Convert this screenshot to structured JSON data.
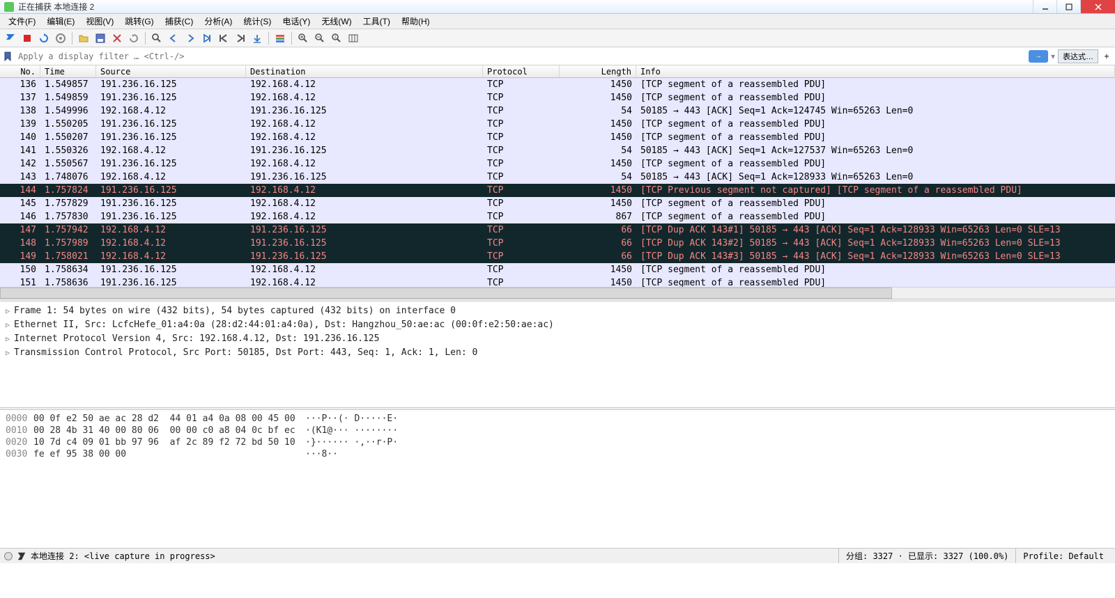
{
  "window": {
    "title": "正在捕获 本地连接 2"
  },
  "menu": {
    "file": "文件(F)",
    "edit": "编辑(E)",
    "view": "视图(V)",
    "goto": "跳转(G)",
    "capture": "捕获(C)",
    "analyze": "分析(A)",
    "stats": "统计(S)",
    "telephony": "电话(Y)",
    "wireless": "无线(W)",
    "tools": "工具(T)",
    "help": "帮助(H)"
  },
  "filter": {
    "placeholder": "Apply a display filter … <Ctrl-/>",
    "expression": "表达式…"
  },
  "columns": {
    "no": "No.",
    "time": "Time",
    "source": "Source",
    "destination": "Destination",
    "protocol": "Protocol",
    "length": "Length",
    "info": "Info"
  },
  "packets": [
    {
      "no": "136",
      "time": "1.549857",
      "src": "191.236.16.125",
      "dst": "192.168.4.12",
      "proto": "TCP",
      "len": "1450",
      "info": "[TCP segment of a reassembled PDU]",
      "style": "normal"
    },
    {
      "no": "137",
      "time": "1.549859",
      "src": "191.236.16.125",
      "dst": "192.168.4.12",
      "proto": "TCP",
      "len": "1450",
      "info": "[TCP segment of a reassembled PDU]",
      "style": "normal"
    },
    {
      "no": "138",
      "time": "1.549996",
      "src": "192.168.4.12",
      "dst": "191.236.16.125",
      "proto": "TCP",
      "len": "54",
      "info": "50185 → 443 [ACK] Seq=1 Ack=124745 Win=65263 Len=0",
      "style": "normal"
    },
    {
      "no": "139",
      "time": "1.550205",
      "src": "191.236.16.125",
      "dst": "192.168.4.12",
      "proto": "TCP",
      "len": "1450",
      "info": "[TCP segment of a reassembled PDU]",
      "style": "normal"
    },
    {
      "no": "140",
      "time": "1.550207",
      "src": "191.236.16.125",
      "dst": "192.168.4.12",
      "proto": "TCP",
      "len": "1450",
      "info": "[TCP segment of a reassembled PDU]",
      "style": "normal"
    },
    {
      "no": "141",
      "time": "1.550326",
      "src": "192.168.4.12",
      "dst": "191.236.16.125",
      "proto": "TCP",
      "len": "54",
      "info": "50185 → 443 [ACK] Seq=1 Ack=127537 Win=65263 Len=0",
      "style": "normal"
    },
    {
      "no": "142",
      "time": "1.550567",
      "src": "191.236.16.125",
      "dst": "192.168.4.12",
      "proto": "TCP",
      "len": "1450",
      "info": "[TCP segment of a reassembled PDU]",
      "style": "normal"
    },
    {
      "no": "143",
      "time": "1.748076",
      "src": "192.168.4.12",
      "dst": "191.236.16.125",
      "proto": "TCP",
      "len": "54",
      "info": "50185 → 443 [ACK] Seq=1 Ack=128933 Win=65263 Len=0",
      "style": "normal"
    },
    {
      "no": "144",
      "time": "1.757824",
      "src": "191.236.16.125",
      "dst": "192.168.4.12",
      "proto": "TCP",
      "len": "1450",
      "info": "[TCP Previous segment not captured]  [TCP segment of a reassembled PDU]",
      "style": "dark"
    },
    {
      "no": "145",
      "time": "1.757829",
      "src": "191.236.16.125",
      "dst": "192.168.4.12",
      "proto": "TCP",
      "len": "1450",
      "info": "[TCP segment of a reassembled PDU]",
      "style": "normal"
    },
    {
      "no": "146",
      "time": "1.757830",
      "src": "191.236.16.125",
      "dst": "192.168.4.12",
      "proto": "TCP",
      "len": "867",
      "info": "[TCP segment of a reassembled PDU]",
      "style": "normal"
    },
    {
      "no": "147",
      "time": "1.757942",
      "src": "192.168.4.12",
      "dst": "191.236.16.125",
      "proto": "TCP",
      "len": "66",
      "info": "[TCP Dup ACK 143#1] 50185 → 443 [ACK] Seq=1 Ack=128933 Win=65263 Len=0 SLE=13",
      "style": "dark"
    },
    {
      "no": "148",
      "time": "1.757989",
      "src": "192.168.4.12",
      "dst": "191.236.16.125",
      "proto": "TCP",
      "len": "66",
      "info": "[TCP Dup ACK 143#2] 50185 → 443 [ACK] Seq=1 Ack=128933 Win=65263 Len=0 SLE=13",
      "style": "dark"
    },
    {
      "no": "149",
      "time": "1.758021",
      "src": "192.168.4.12",
      "dst": "191.236.16.125",
      "proto": "TCP",
      "len": "66",
      "info": "[TCP Dup ACK 143#3] 50185 → 443 [ACK] Seq=1 Ack=128933 Win=65263 Len=0 SLE=13",
      "style": "dark"
    },
    {
      "no": "150",
      "time": "1.758634",
      "src": "191.236.16.125",
      "dst": "192.168.4.12",
      "proto": "TCP",
      "len": "1450",
      "info": "[TCP segment of a reassembled PDU]",
      "style": "normal"
    },
    {
      "no": "151",
      "time": "1.758636",
      "src": "191.236.16.125",
      "dst": "192.168.4.12",
      "proto": "TCP",
      "len": "1450",
      "info": "[TCP segment of a reassembled PDU]",
      "style": "normal"
    }
  ],
  "details": [
    "Frame 1: 54 bytes on wire (432 bits), 54 bytes captured (432 bits) on interface 0",
    "Ethernet II, Src: LcfcHefe_01:a4:0a (28:d2:44:01:a4:0a), Dst: Hangzhou_50:ae:ac (00:0f:e2:50:ae:ac)",
    "Internet Protocol Version 4, Src: 192.168.4.12, Dst: 191.236.16.125",
    "Transmission Control Protocol, Src Port: 50185, Dst Port: 443, Seq: 1, Ack: 1, Len: 0"
  ],
  "hex": [
    {
      "off": "0000",
      "b": "00 0f e2 50 ae ac 28 d2  44 01 a4 0a 08 00 45 00",
      "a": "···P··(· D·····E·"
    },
    {
      "off": "0010",
      "b": "00 28 4b 31 40 00 80 06  00 00 c0 a8 04 0c bf ec",
      "a": "·(K1@··· ········"
    },
    {
      "off": "0020",
      "b": "10 7d c4 09 01 bb 97 96  af 2c 89 f2 72 bd 50 10",
      "a": "·}······ ·,··r·P·"
    },
    {
      "off": "0030",
      "b": "fe ef 95 38 00 00",
      "a": "···8··"
    }
  ],
  "status": {
    "left": "本地连接 2: <live capture in progress>",
    "packets": "分组: 3327 · 已显示: 3327 (100.0%)",
    "profile": "Profile: Default"
  }
}
